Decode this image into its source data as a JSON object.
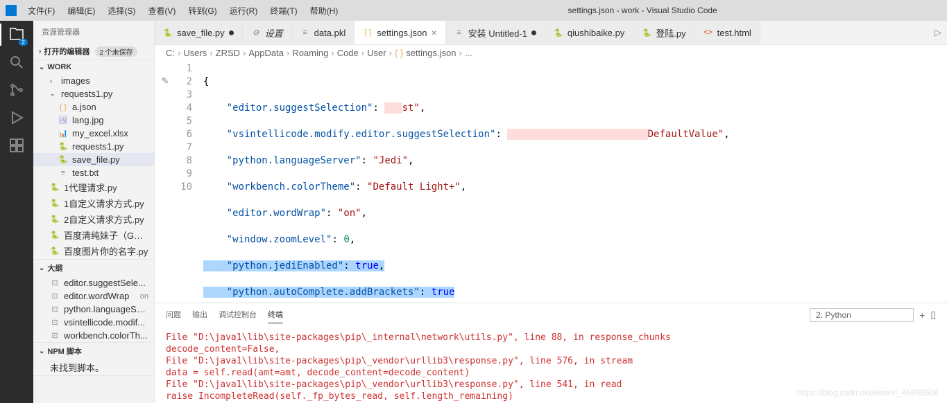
{
  "titlebar": {
    "title": "settings.json - work - Visual Studio Code",
    "menu": [
      "文件(F)",
      "编辑(E)",
      "选择(S)",
      "查看(V)",
      "转到(G)",
      "运行(R)",
      "终端(T)",
      "帮助(H)"
    ]
  },
  "activity": {
    "badge": "2"
  },
  "sidebar": {
    "title": "资源管理器",
    "sections": {
      "openEditors": {
        "label": "打开的编辑器",
        "badge": "2 个未保存"
      },
      "work": {
        "label": "WORK"
      },
      "outline": {
        "label": "大纲"
      },
      "npm": {
        "label": "NPM 脚本",
        "empty": "未找到脚本。"
      }
    },
    "tree": {
      "images": "images",
      "requests1": "requests1.py",
      "items": [
        {
          "icon": "json",
          "name": "a.json"
        },
        {
          "icon": "img",
          "name": "lang.jpg"
        },
        {
          "icon": "xlsx",
          "name": "my_excel.xlsx"
        },
        {
          "icon": "py",
          "name": "requests1.py"
        },
        {
          "icon": "py",
          "name": "save_file.py",
          "selected": true
        },
        {
          "icon": "txt",
          "name": "test.txt"
        }
      ],
      "rootItems": [
        {
          "icon": "py",
          "name": "1代理请求.py"
        },
        {
          "icon": "py",
          "name": "1自定义请求方式.py"
        },
        {
          "icon": "py",
          "name": "2自定义请求方式.py"
        },
        {
          "icon": "py",
          "name": "百度清纯妹子（GET..."
        },
        {
          "icon": "py",
          "name": "百度图片你的名字.py"
        }
      ]
    },
    "outline": [
      {
        "name": "editor.suggestSele..."
      },
      {
        "name": "editor.wordWrap",
        "value": "on"
      },
      {
        "name": "python.languageSe..."
      },
      {
        "name": "vsintellicode.modif..."
      },
      {
        "name": "workbench.colorTh..."
      }
    ]
  },
  "tabs": [
    {
      "icon": "py",
      "label": "save_file.py",
      "modified": true
    },
    {
      "icon": "settings",
      "label": "设置",
      "italic": true
    },
    {
      "icon": "data",
      "label": "data.pkl"
    },
    {
      "icon": "json",
      "label": "settings.json",
      "active": true,
      "close": true
    },
    {
      "icon": "txt",
      "label": "安装 Untitled-1",
      "modified": true
    },
    {
      "icon": "py",
      "label": "qiushibaike.py"
    },
    {
      "icon": "py",
      "label": "登陆.py"
    },
    {
      "icon": "html",
      "label": "test.html"
    }
  ],
  "breadcrumbs": [
    "C:",
    "Users",
    "ZRSD",
    "AppData",
    "Roaming",
    "Code",
    "User",
    "settings.json",
    "..."
  ],
  "code": {
    "lines": [
      "{",
      "    \"editor.suggestSelection\": \"   st\",",
      "    \"vsintellicode.modify.editor.suggestSelection\": \"                        DefaultValue\",",
      "    \"python.languageServer\": \"Jedi\",",
      "    \"workbench.colorTheme\": \"Default Light+\",",
      "    \"editor.wordWrap\": \"on\",",
      "    \"window.zoomLevel\": 0,",
      "    \"python.jediEnabled\": true,",
      "    \"python.autoComplete.addBrackets\": true",
      "}"
    ]
  },
  "panel": {
    "tabs": [
      "问题",
      "输出",
      "调试控制台",
      "终端"
    ],
    "activeTab": "终端",
    "select": "2: Python",
    "terminal": [
      "File \"D:\\java1\\lib\\site-packages\\pip\\_internal\\network\\utils.py\", line 88, in response_chunks",
      "  decode_content=False,",
      "File \"D:\\java1\\lib\\site-packages\\pip\\_vendor\\urllib3\\response.py\", line 576, in stream",
      "  data = self.read(amt=amt, decode_content=decode_content)",
      "File \"D:\\java1\\lib\\site-packages\\pip\\_vendor\\urllib3\\response.py\", line 541, in read",
      "  raise IncompleteRead(self._fp_bytes_read, self.length_remaining)"
    ]
  },
  "watermark": "https://blog.csdn.net/weixin_45698506"
}
